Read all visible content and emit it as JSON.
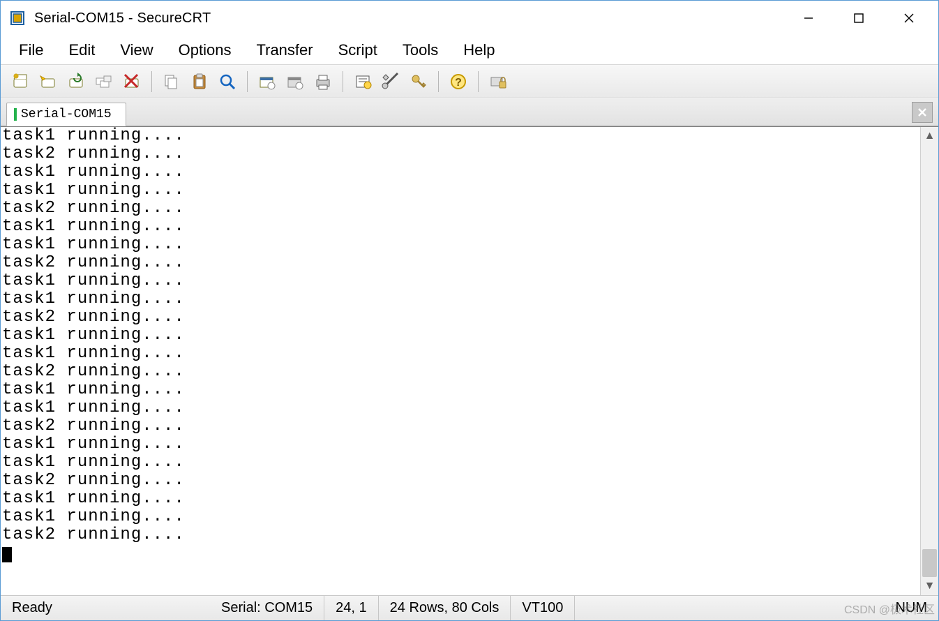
{
  "title": "Serial-COM15 - SecureCRT",
  "menu": [
    "File",
    "Edit",
    "View",
    "Options",
    "Transfer",
    "Script",
    "Tools",
    "Help"
  ],
  "toolbar_icons": [
    "new-session-icon",
    "quick-connect-icon",
    "reconnect-icon",
    "session-manager-icon",
    "disconnect-icon",
    "SEP",
    "copy-icon",
    "paste-icon",
    "find-icon",
    "SEP",
    "session-options-icon",
    "global-options-icon",
    "print-icon",
    "SEP",
    "properties-icon",
    "keymap-icon",
    "key-icon",
    "SEP",
    "help-icon",
    "SEP",
    "lock-session-icon"
  ],
  "tab": {
    "label": "Serial-COM15"
  },
  "terminal_lines": [
    "task1 running....",
    "task2 running....",
    "task1 running....",
    "task1 running....",
    "task2 running....",
    "task1 running....",
    "task1 running....",
    "task2 running....",
    "task1 running....",
    "task1 running....",
    "task2 running....",
    "task1 running....",
    "task1 running....",
    "task2 running....",
    "task1 running....",
    "task1 running....",
    "task2 running....",
    "task1 running....",
    "task1 running....",
    "task2 running....",
    "task1 running....",
    "task1 running....",
    "task2 running...."
  ],
  "status": {
    "ready": "Ready",
    "conn": "Serial: COM15",
    "cursor": "24,   1",
    "size": "24 Rows,  80 Cols",
    "emulation": "VT100",
    "numlock": "NUM"
  },
  "watermark": "CSDN @极术社区"
}
